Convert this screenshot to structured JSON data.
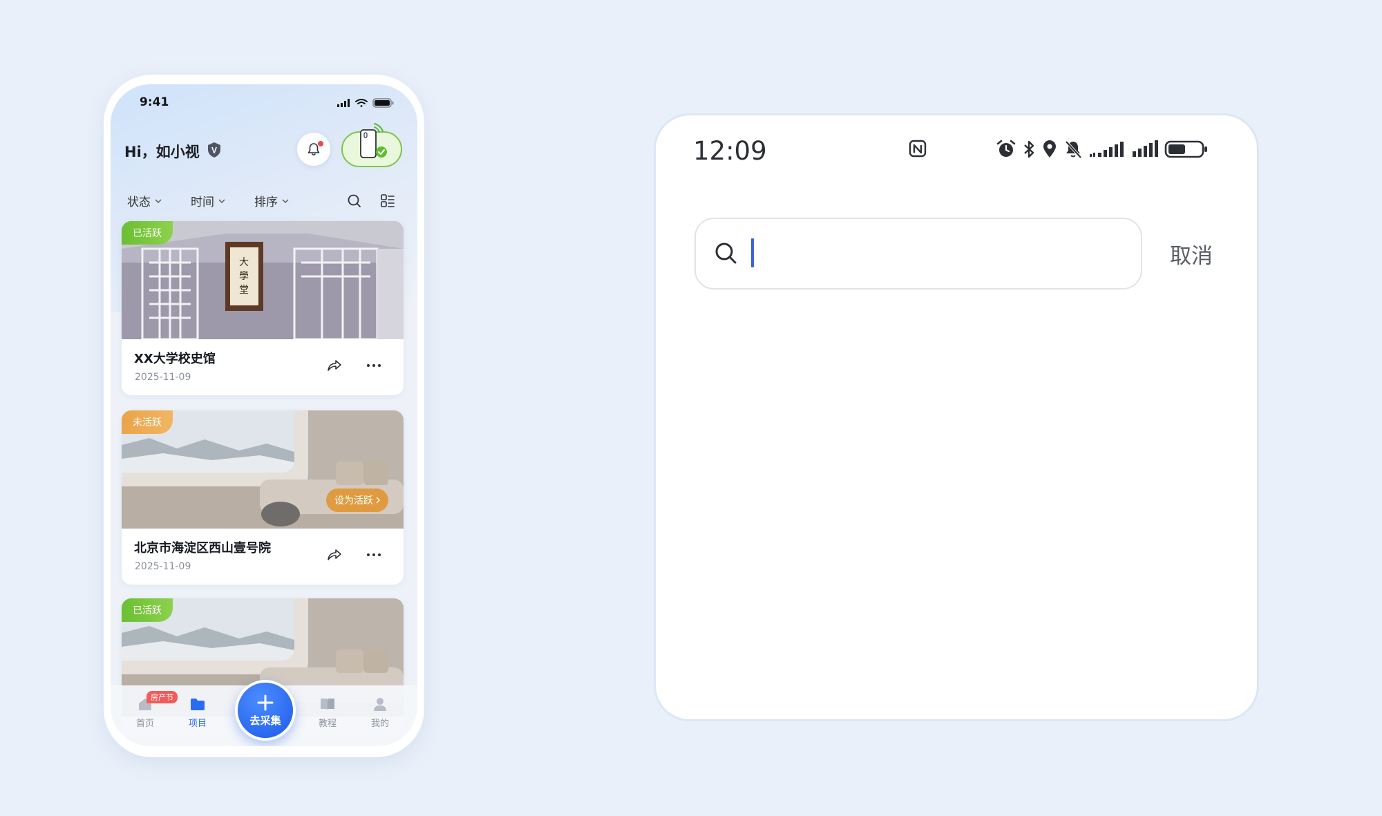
{
  "left_phone": {
    "status_bar": {
      "time": "9:41"
    },
    "header": {
      "greeting": "Hi，如小视",
      "badge_letter": "V"
    },
    "filters": [
      {
        "label": "状态"
      },
      {
        "label": "时间"
      },
      {
        "label": "排序"
      }
    ],
    "projects": [
      {
        "tag": "已活跃",
        "tag_color": "#6bbf33",
        "title": "XX大学校史馆",
        "date": "2025-11-09",
        "image": "museum-hall"
      },
      {
        "tag": "未活跃",
        "tag_color": "#eaa44a",
        "title": "北京市海淀区西山壹号院",
        "date": "2025-11-09",
        "image": "living-room",
        "action_label": "设为活跃"
      },
      {
        "tag": "已活跃",
        "tag_color": "#6bbf33",
        "image": "living-room"
      }
    ],
    "bottom_nav": {
      "items": [
        {
          "label": "首页",
          "icon": "home-icon",
          "badge": "房产节"
        },
        {
          "label": "项目",
          "icon": "folder-icon",
          "active": true
        },
        {
          "label": "教程",
          "icon": "book-icon"
        },
        {
          "label": "我的",
          "icon": "user-icon"
        }
      ],
      "fab_label": "去采集"
    },
    "colors": {
      "accent": "#2a6bf0",
      "active_green": "#6bbf33",
      "inactive_orange": "#eaa44a"
    }
  },
  "right_phone": {
    "status_bar": {
      "time": "12:09"
    },
    "search": {
      "placeholder": ""
    },
    "cancel_label": "取消",
    "colors": {
      "caret": "#3a63e0"
    }
  }
}
